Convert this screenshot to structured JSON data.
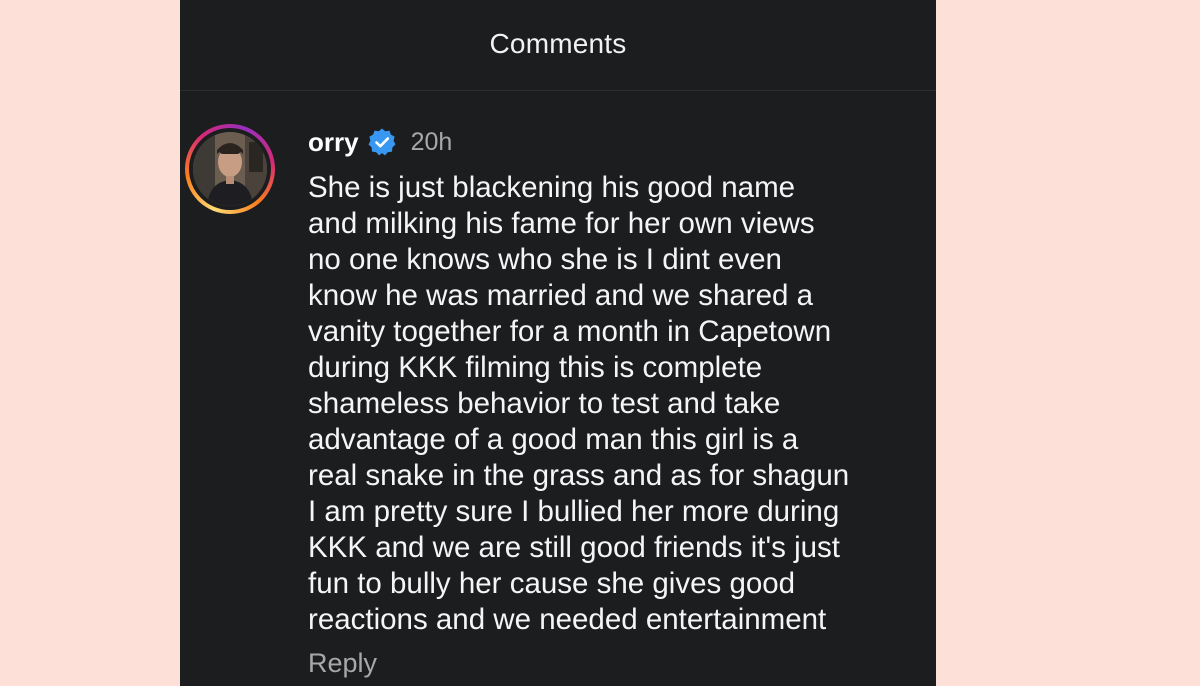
{
  "header": {
    "title": "Comments"
  },
  "comment": {
    "username": "orry",
    "verified_icon": "verified-badge-icon",
    "time": "20h",
    "text": "She is just blackening his good name\nand milking his fame for her own views\nno one knows who she is I dint even\nknow he was married and we shared a\nvanity together for a month in Capetown\nduring KKK filming this is complete\nshameless behavior to test and take\nadvantage of a good man this girl is a\nreal snake in the grass and as for shagun\nI am pretty sure I bullied her more during\nKKK and we are still good friends it's just\nfun to bully her cause she gives good\nreactions and we needed entertainment",
    "reply_label": "Reply"
  },
  "colors": {
    "page_background": "#fde0d8",
    "panel_background": "#1c1d1f",
    "verified_blue": "#3897f0",
    "muted_text": "#a8a8a8"
  }
}
